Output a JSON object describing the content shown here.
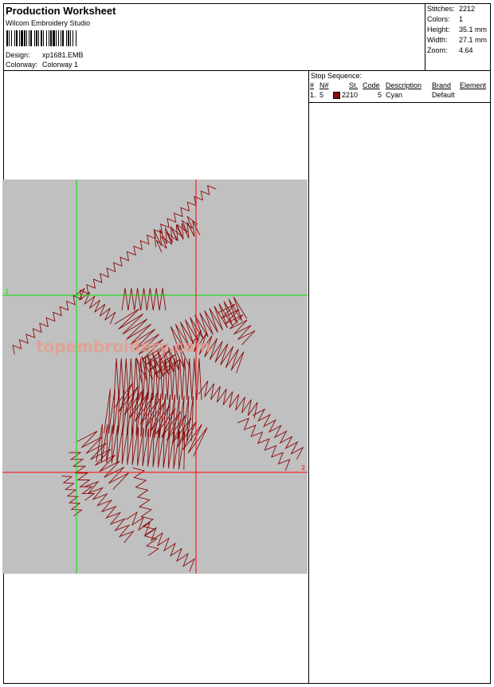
{
  "title": "Production Worksheet",
  "software": "Wilcom Embroidery Studio",
  "design": {
    "label": "Design:",
    "value": "xp1681.EMB"
  },
  "colorway": {
    "label": "Colorway:",
    "value": "Colorway 1"
  },
  "stats": [
    {
      "label": "Stitches:",
      "value": "2212"
    },
    {
      "label": "Colors:",
      "value": "1"
    },
    {
      "label": "Height:",
      "value": "35.1 mm"
    },
    {
      "label": "Width:",
      "value": "27.1 mm"
    },
    {
      "label": "Zoom:",
      "value": "4.64"
    }
  ],
  "stop_sequence": {
    "title": "Stop Sequence:",
    "headers": {
      "num": "#",
      "n": "N#",
      "st": "St.",
      "code": "Code",
      "description": "Description",
      "brand": "Brand",
      "element": "Element"
    },
    "rows": [
      {
        "num": "1.",
        "n": "5",
        "color": "#8b0a0a",
        "st": "2210",
        "code": "5",
        "description": "Cyan",
        "brand": "Default",
        "element": ""
      }
    ]
  },
  "canvas": {
    "background": "#c0c0c0",
    "thread_color": "#8b0a0a",
    "guide_green": "#00e000",
    "guide_red": "#ff0000",
    "marker_1": "1",
    "marker_2": "2",
    "watermark": "topembroidery.com",
    "watermark_color": "#e89a8a"
  },
  "colors": {
    "border": "#000000",
    "page": "#ffffff"
  }
}
